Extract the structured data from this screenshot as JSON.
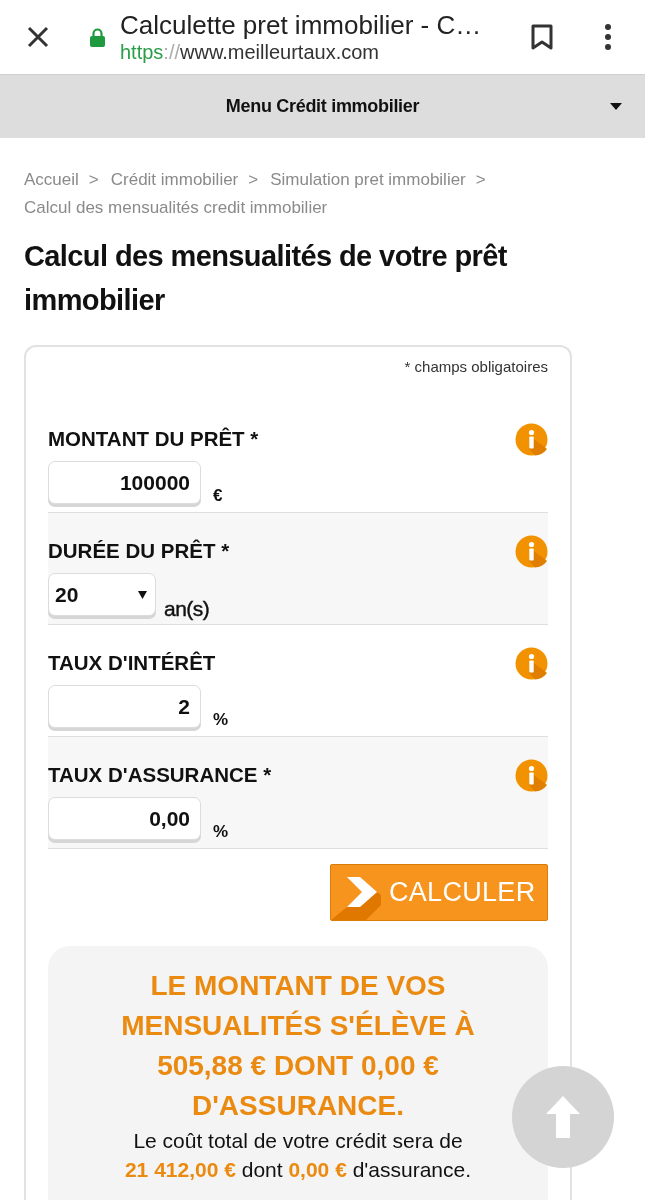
{
  "browser_bar": {
    "title": "Calculette pret immobilier - C…",
    "url": {
      "scheme": "https",
      "separator": "://",
      "host": "www.meilleurtaux.com"
    }
  },
  "menu_bar": {
    "label": "Menu Crédit immobilier"
  },
  "breadcrumb": [
    {
      "label": "Accueil",
      "separator": ">"
    },
    {
      "label": "Crédit immobilier",
      "separator": ">"
    },
    {
      "label": "Simulation pret immobilier",
      "separator": ">"
    },
    {
      "label": "Calcul des mensualités credit immobilier"
    }
  ],
  "page_title": "Calcul des mensualités de votre prêt immobilier",
  "form": {
    "required_note": "* champs obligatoires",
    "fields": [
      {
        "kind": "input",
        "label": "MONTANT DU PRÊT *",
        "value": "100000",
        "unit": "€"
      },
      {
        "kind": "select",
        "label": "DURÉE DU PRÊT *",
        "value": "20",
        "unit": "an(s)"
      },
      {
        "kind": "input",
        "label": "TAUX D'INTÉRÊT",
        "value": "2",
        "unit": "%"
      },
      {
        "kind": "input",
        "label": "TAUX D'ASSURANCE *",
        "value": "0,00",
        "unit": "%"
      }
    ],
    "submit": "CALCULER"
  },
  "result": {
    "headline": "LE MONTANT DE VOS MENSUALITÉS S'ÉLÈVE À 505,88 € DONT 0,00 € D'ASSURANCE.",
    "detail": "Le coût total de votre crédit sera de **21 412,00 €** dont **0,00 €** d'assurance."
  }
}
